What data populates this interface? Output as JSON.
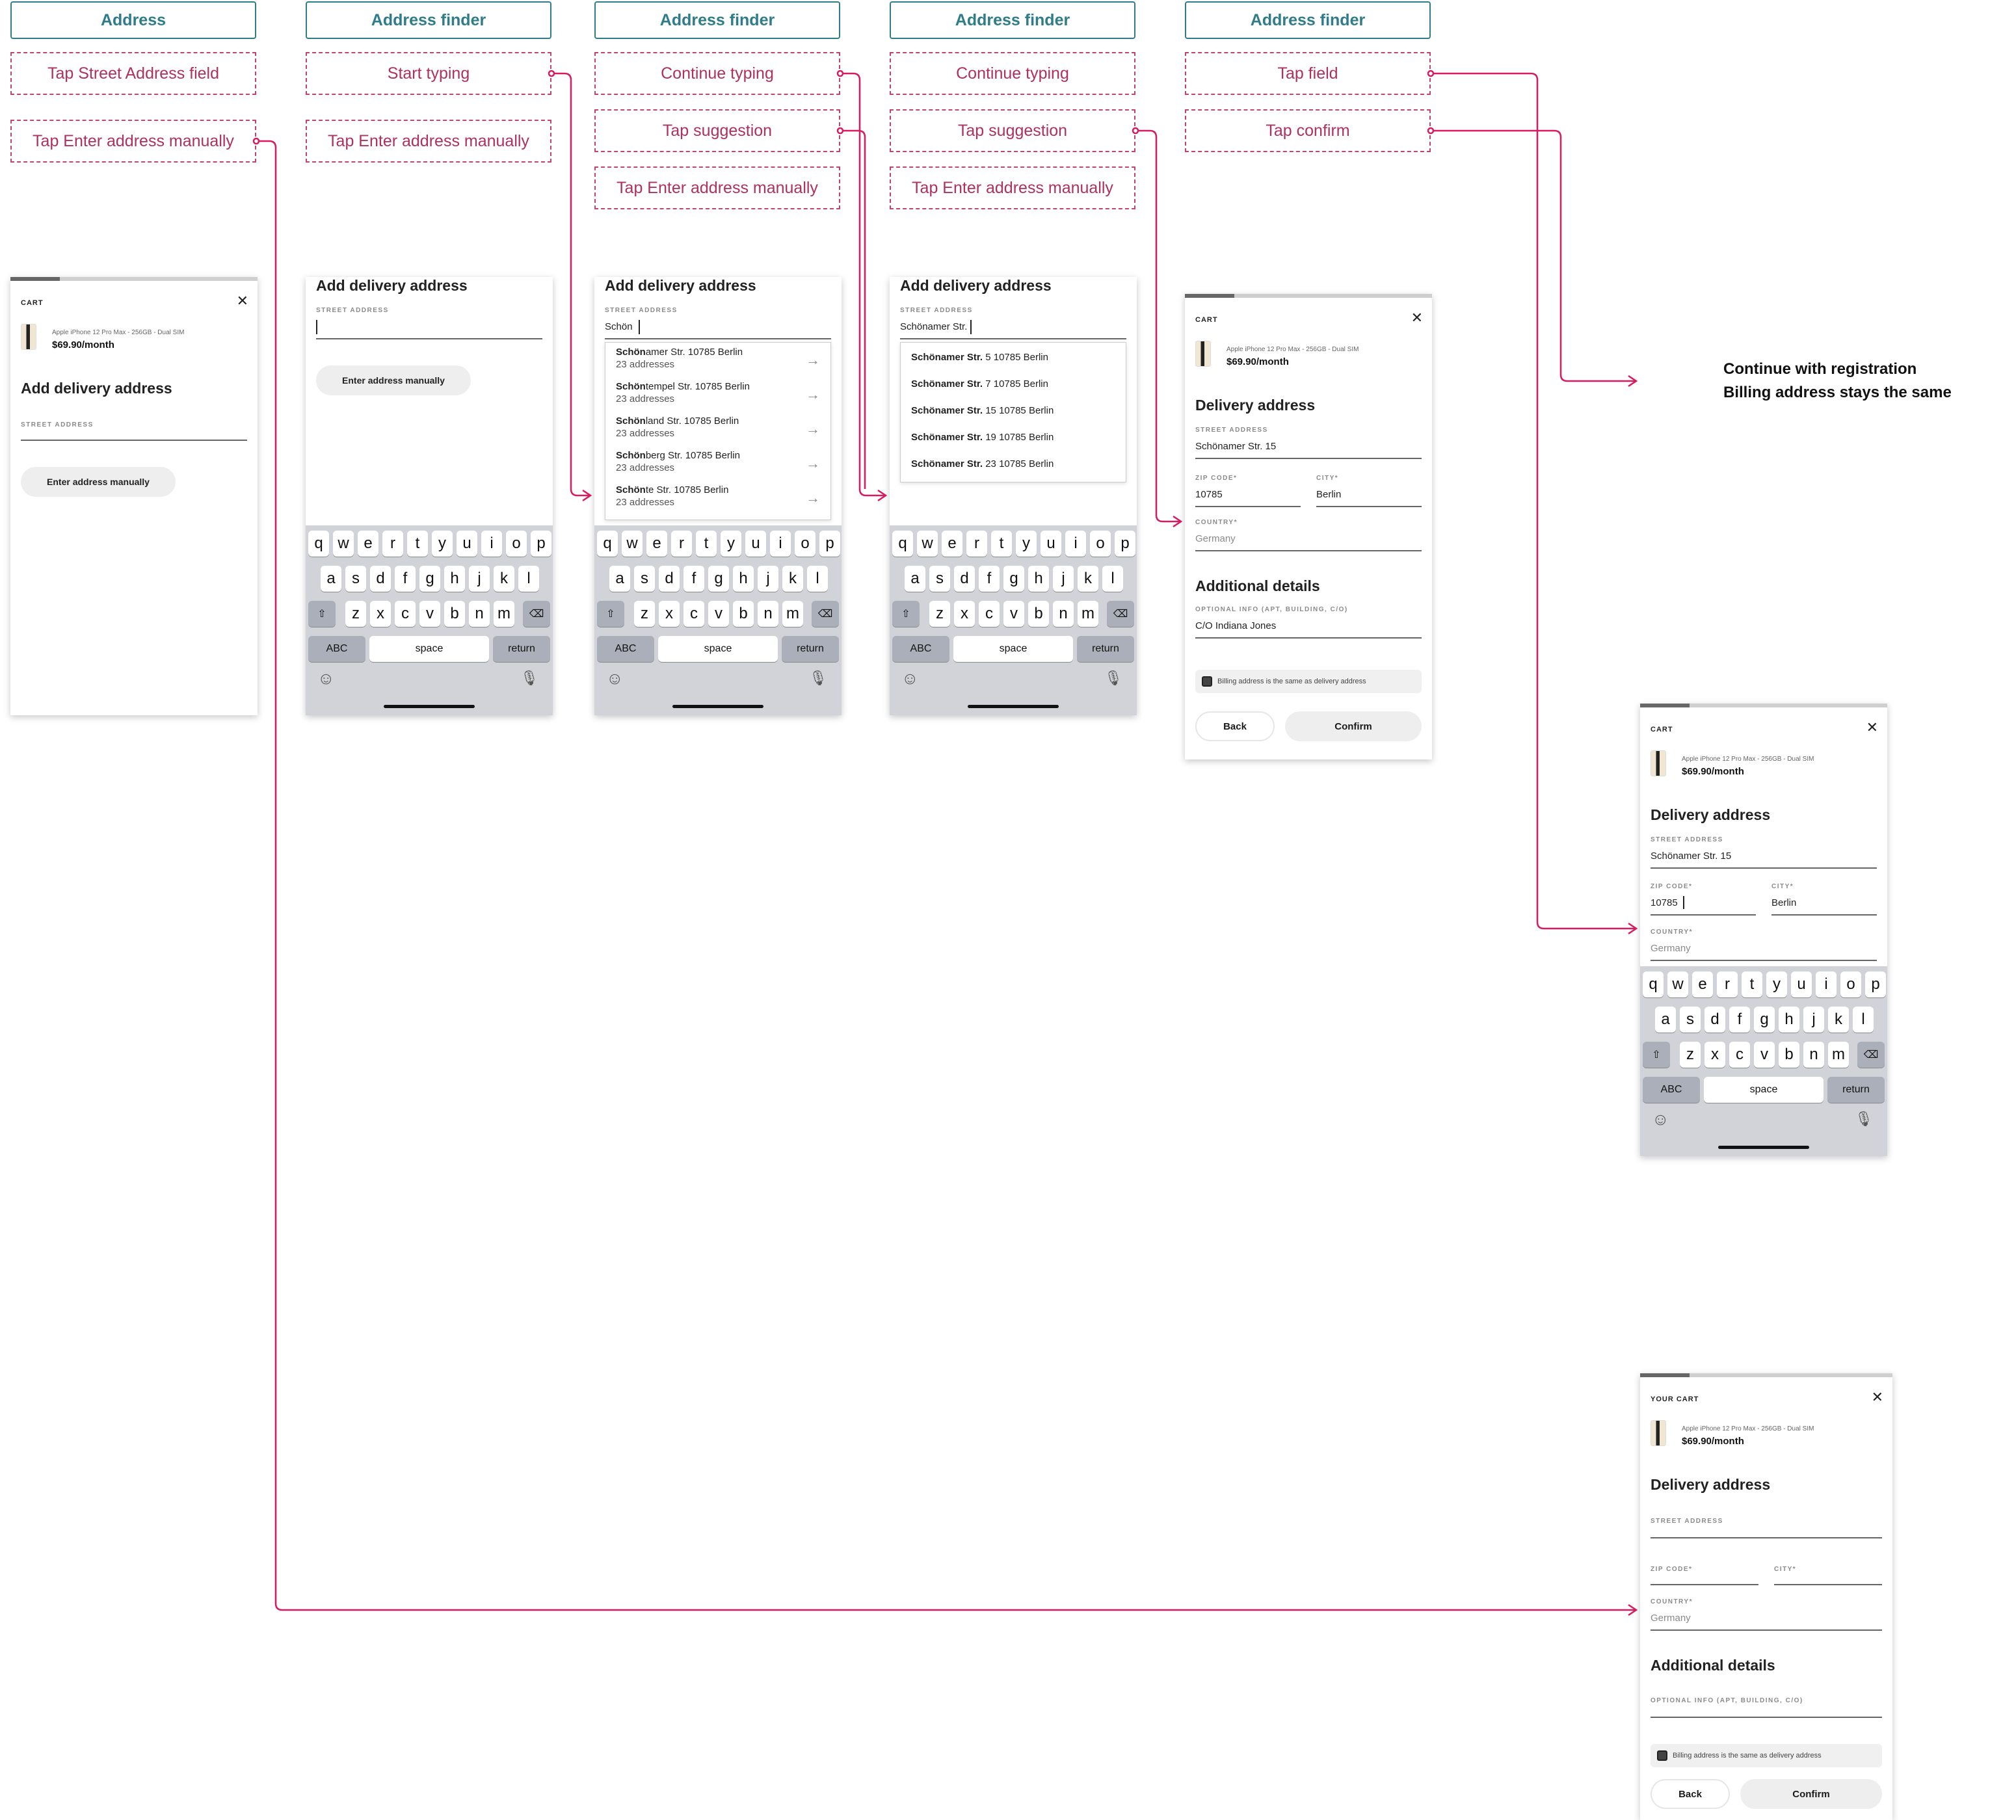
{
  "columns": [
    {
      "header": "Address",
      "actions": [
        "Tap Street Address field",
        "Tap Enter address manually"
      ]
    },
    {
      "header": "Address finder",
      "actions": [
        "Start typing",
        "Tap Enter address manually"
      ]
    },
    {
      "header": "Address finder",
      "actions": [
        "Continue typing",
        "Tap suggestion",
        "Tap Enter address manually"
      ]
    },
    {
      "header": "Address finder",
      "actions": [
        "Continue typing",
        "Tap suggestion",
        "Tap Enter address manually"
      ]
    },
    {
      "header": "Address finder",
      "actions": [
        "Tap field",
        "Tap confirm"
      ]
    }
  ],
  "note": {
    "line1": "Continue with registration",
    "line2": "Billing address stays the same"
  },
  "cart": {
    "label": "CART",
    "label_alt": "YOUR CART",
    "close": "✕",
    "product": "Apple iPhone 12 Pro Max - 256GB - Dual SIM",
    "price": "$69.90/month"
  },
  "form": {
    "add_title": "Add delivery address",
    "delivery_title": "Delivery address",
    "additional_title": "Additional details",
    "street_label": "STREET ADDRESS",
    "zip_label": "ZIP CODE*",
    "city_label": "CITY*",
    "country_label": "COUNTRY*",
    "optional_label": "OPTIONAL INFO (APT, BUILDING, C/O)",
    "manual_button": "Enter address manually",
    "typed_1": "Schön",
    "typed_2": "Schönamer Str.",
    "street_value": "Schönamer Str. 15",
    "zip_value": "10785",
    "city_value": "Berlin",
    "country_value": "Germany",
    "optional_value": "C/O Indiana Jones",
    "billing_check": "Billing address is the same as delivery address",
    "back": "Back",
    "confirm": "Confirm"
  },
  "suggestions_1": [
    {
      "bold": "Schön",
      "rest": "amer Str. 10785 Berlin",
      "sub": "23 addresses"
    },
    {
      "bold": "Schön",
      "rest": "tempel Str. 10785 Berlin",
      "sub": "23 addresses"
    },
    {
      "bold": "Schön",
      "rest": "land Str. 10785 Berlin",
      "sub": "23 addresses"
    },
    {
      "bold": "Schön",
      "rest": "berg Str. 10785 Berlin",
      "sub": "23 addresses"
    },
    {
      "bold": "Schön",
      "rest": "te Str. 10785 Berlin",
      "sub": "23 addresses"
    }
  ],
  "suggestions_2": [
    {
      "bold": "Schönamer Str.",
      "rest": " 5 10785 Berlin"
    },
    {
      "bold": "Schönamer Str.",
      "rest": " 7 10785 Berlin"
    },
    {
      "bold": "Schönamer Str.",
      "rest": " 15 10785 Berlin"
    },
    {
      "bold": "Schönamer Str.",
      "rest": " 19 10785 Berlin"
    },
    {
      "bold": "Schönamer Str.",
      "rest": " 23 10785 Berlin"
    }
  ],
  "keyboard": {
    "row1": [
      "q",
      "w",
      "e",
      "r",
      "t",
      "y",
      "u",
      "i",
      "o",
      "p"
    ],
    "row2": [
      "a",
      "s",
      "d",
      "f",
      "g",
      "h",
      "j",
      "k",
      "l"
    ],
    "row3": [
      "z",
      "x",
      "c",
      "v",
      "b",
      "n",
      "m"
    ],
    "abc": "ABC",
    "space": "space",
    "return": "return",
    "shift": "⇧",
    "delete": "⌫",
    "emoji": "☺",
    "mic": "🎙"
  },
  "colors": {
    "header": "#2e7d88",
    "action": "#b0305e",
    "connector": "#d81b60"
  }
}
